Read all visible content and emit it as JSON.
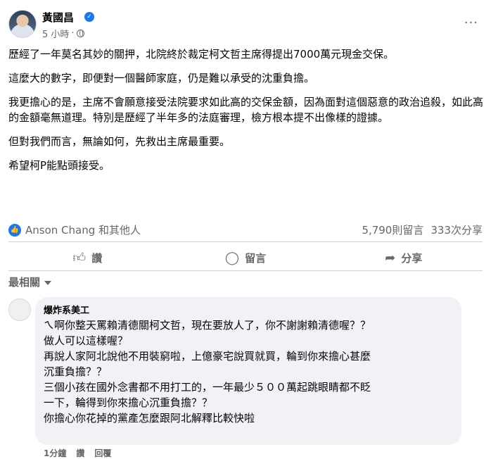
{
  "post": {
    "author": "黃國昌",
    "time": "5 小時",
    "more_label": "···",
    "paragraphs": [
      "歷經了一年莫名其妙的關押，北院終於裁定柯文哲主席得提出7000萬元現金交保。",
      "這麼大的數字，即便對一個醫師家庭，仍是難以承受的沈重負擔。",
      "我更擔心的是，主席不會願意接受法院要求如此高的交保金額，因為面對這個惡意的政治追殺，如此高的金額毫無道理。特別是歷經了半年多的法庭審理，檢方根本提不出像樣的證據。",
      "但對我們而言，無論如何，先救出主席最重要。",
      "希望柯P能點頭接受。"
    ]
  },
  "reactions": {
    "text": "Anson Chang 和其他人",
    "comments": "5,790則留言",
    "shares": "333次分享"
  },
  "actions": {
    "like": "讚",
    "comment": "留言",
    "share": "分享"
  },
  "sort_label": "最相關",
  "comment": {
    "author": "爆炸系美工",
    "lines": [
      "ㄟ啊你整天罵賴清德關柯文哲，現在要放人了，你不謝謝賴清德喔？？",
      "做人可以這樣喔？",
      "再說人家阿北說他不用裝窮啦，上億豪宅說買就買，輪到你來擔心甚麼",
      "沉重負擔？？",
      "三個小孩在國外念書都不用打工的，一年最少５００萬起跳眼睛都不眨",
      "一下，輪得到你來擔心沉重負擔？？",
      "你擔心你花掉的黨產怎麼跟阿北解釋比較快啦"
    ],
    "time": "1分鐘",
    "like_label": "讚",
    "reply_label": "回覆"
  },
  "colors": {
    "accent": "#1877f2",
    "muted": "#65676b",
    "bubble": "#f0f2f5"
  },
  "icons": {
    "verified": "verified-badge-icon",
    "audience": "globe-icon",
    "like": "thumbs-up-icon",
    "comment": "speech-bubble-icon",
    "share": "share-arrow-icon",
    "sort": "caret-down-icon"
  }
}
